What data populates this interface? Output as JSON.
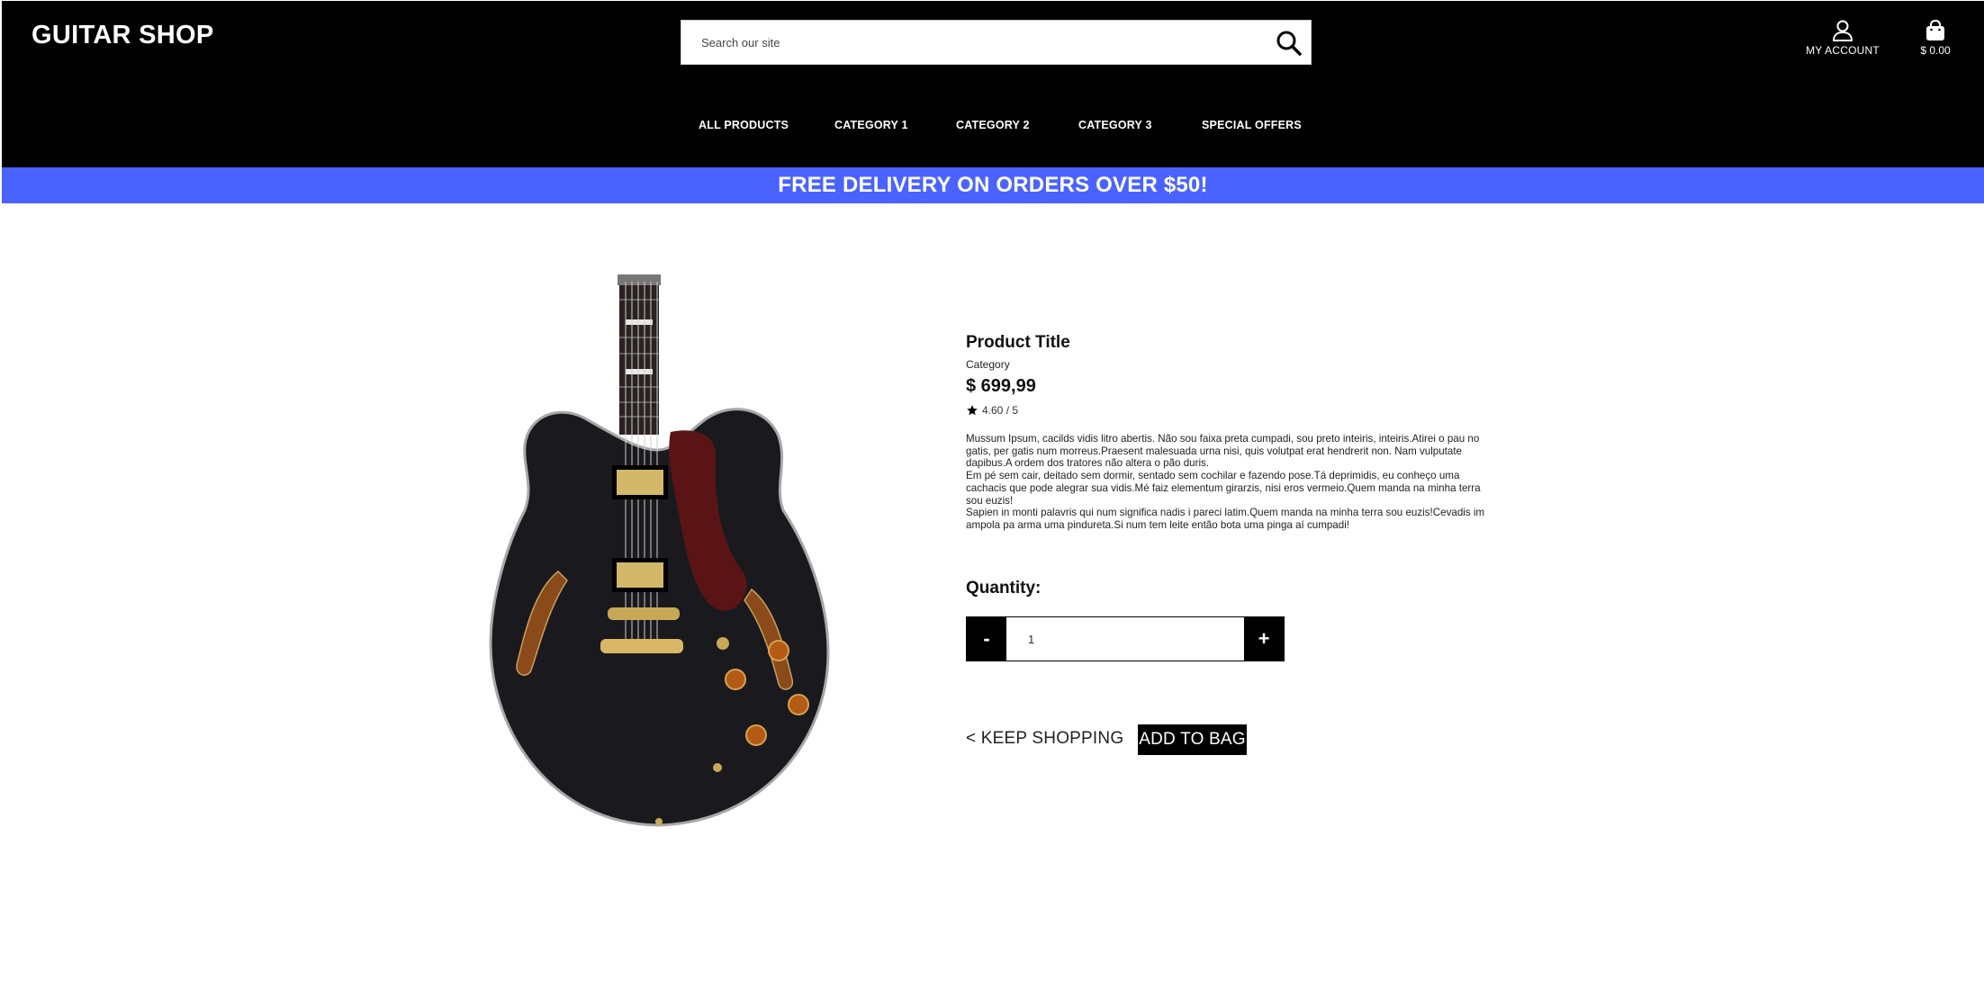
{
  "header": {
    "logo": "GUITAR SHOP",
    "search_placeholder": "Search our site",
    "account_label": "MY ACCOUNT",
    "cart_total": "$ 0.00"
  },
  "nav": {
    "items": [
      "ALL PRODUCTS",
      "CATEGORY 1",
      "CATEGORY 2",
      "CATEGORY 3",
      "SPECIAL OFFERS"
    ]
  },
  "banner": {
    "text": "FREE DELIVERY ON ORDERS OVER $50!"
  },
  "product": {
    "title": "Product Title",
    "category": "Category",
    "price": "$ 699,99",
    "rating": "4.60 / 5",
    "description": [
      "Mussum Ipsum, cacilds vidis litro abertis. Não sou faixa preta cumpadi, sou preto inteiris, inteiris.Atirei o pau no gatis, per gatis num morreus.Praesent malesuada urna nisi, quis volutpat erat hendrerit non. Nam vulputate dapibus.A ordem dos tratores não altera o pão duris.",
      "Em pé sem cair, deitado sem dormir, sentado sem cochilar e fazendo pose.Tá deprimidis, eu conheço uma cachacis que pode alegrar sua vidis.Mé faiz elementum girarzis, nisi eros vermeio.Quem manda na minha terra sou euzis!",
      "Sapien in monti palavris qui num significa nadis i pareci latim.Quem manda na minha terra sou euzis!Cevadis im ampola pa arma uma pindureta.Si num tem leite então bota uma pinga aí cumpadi!"
    ]
  },
  "quantity": {
    "label": "Quantity:",
    "value": "1",
    "minus": "-",
    "plus": "+"
  },
  "actions": {
    "keep_shopping": "< KEEP SHOPPING",
    "add_to_bag": "ADD TO BAG"
  },
  "colors": {
    "header_bg": "#000000",
    "banner_bg": "#4a63ff"
  }
}
